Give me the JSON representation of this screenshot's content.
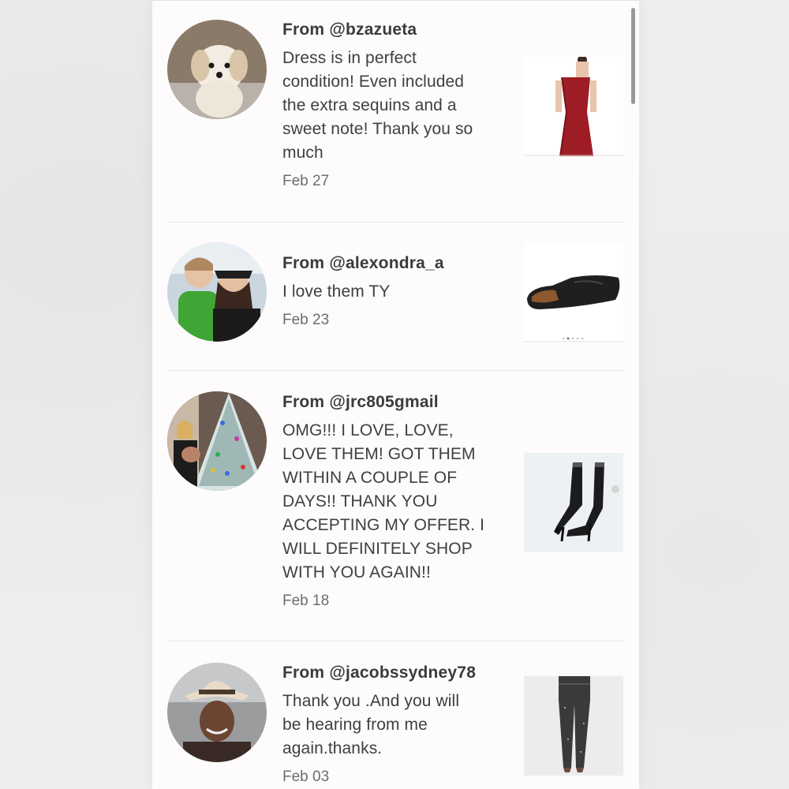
{
  "reviews": [
    {
      "from": "From @bzazueta",
      "message": "Dress is in perfect\ncondition! Even included\nthe extra sequins and a\nsweet note! Thank you so\nmuch",
      "date": "Feb 27",
      "avatar_icon": "dog-avatar-icon",
      "product_icon": "red-sequin-dress-icon"
    },
    {
      "from": "From @alexondra_a",
      "message": "I love them TY",
      "date": "Feb 23",
      "avatar_icon": "two-people-avatar-icon",
      "product_icon": "black-loafer-shoe-icon"
    },
    {
      "from": "From @jrc805gmail",
      "message": "OMG!!! I LOVE, LOVE,\nLOVE THEM! GOT THEM\nWITHIN A COUPLE OF\nDAYS!! THANK YOU\nACCEPTING MY OFFER. I\nWILL DEFINITELY SHOP\nWITH YOU AGAIN!!",
      "date": "Feb 18",
      "avatar_icon": "christmas-tree-avatar-icon",
      "product_icon": "black-sock-boots-icon"
    },
    {
      "from": "From @jacobssydney78",
      "message": "Thank you .And you will\nbe hearing from me\nagain.thanks.",
      "date": "Feb 03",
      "avatar_icon": "woman-hat-avatar-icon",
      "product_icon": "sequin-pants-icon"
    }
  ],
  "colors": {
    "panel_bg": "#fdfbfc",
    "text": "#404040",
    "date": "#6d6d6d",
    "divider": "#e8e6e7"
  }
}
